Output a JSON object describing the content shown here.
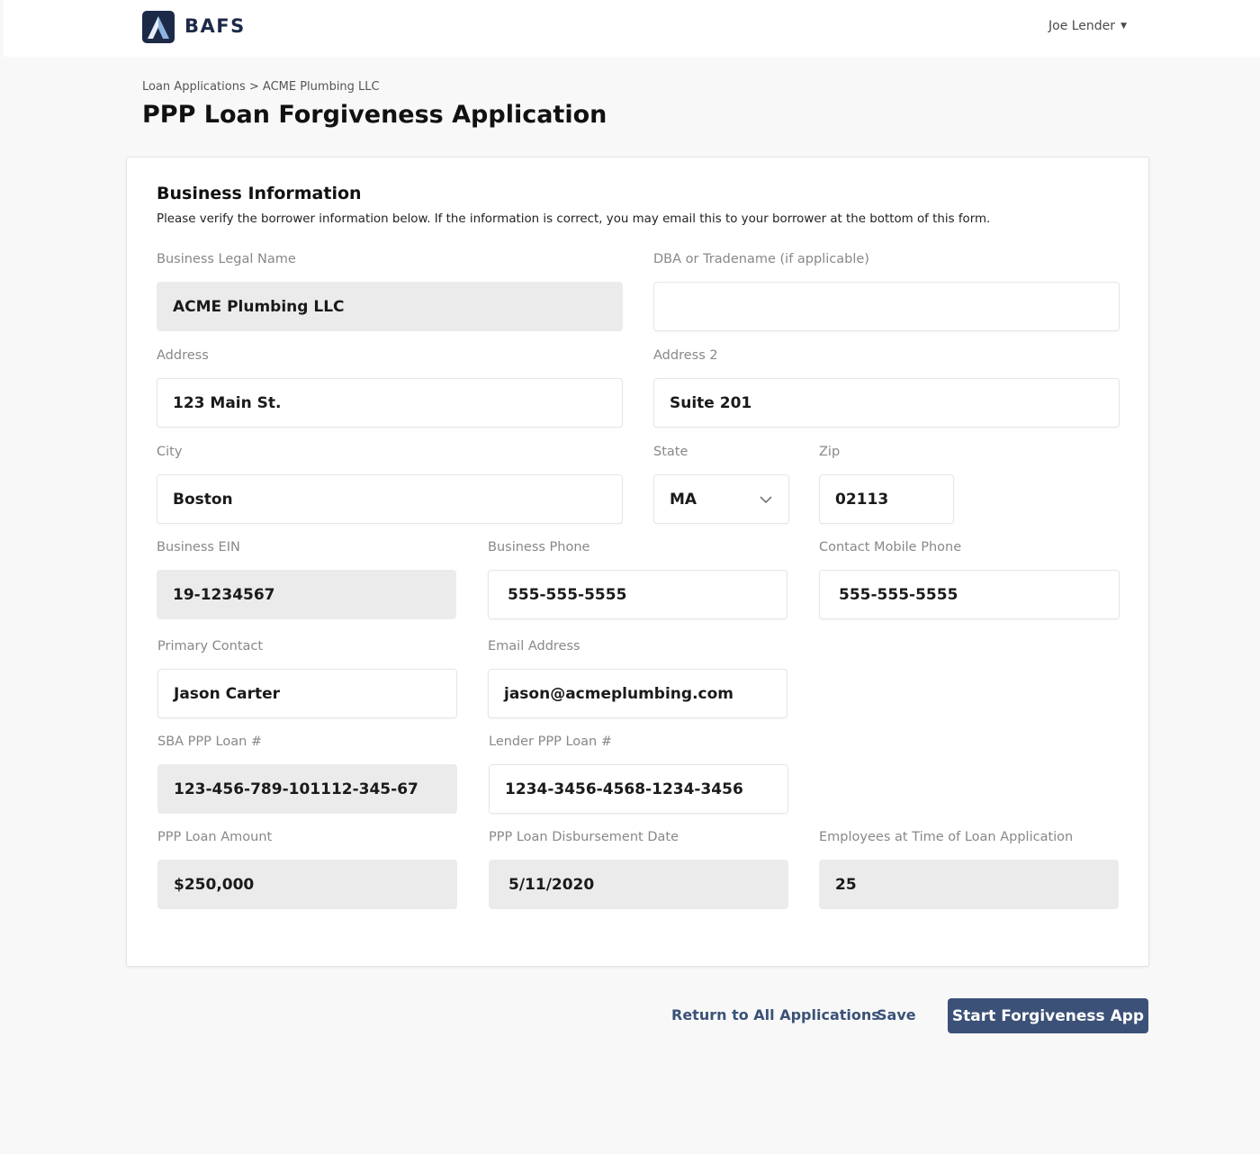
{
  "header": {
    "brand": "BAFS",
    "logo_icon": "bafs-logo-icon",
    "user_name": "Joe Lender",
    "user_menu_icon": "caret-down-icon"
  },
  "breadcrumb": {
    "parent": "Loan Applications",
    "separator": ">",
    "current": "ACME Plumbing LLC",
    "full": "Loan Applications > ACME Plumbing LLC"
  },
  "page": {
    "title": "PPP Loan Forgiveness Application"
  },
  "section": {
    "title": "Business Information",
    "description": "Please verify the borrower information below. If the information is correct, you may email this to your borrower at the bottom of this form."
  },
  "fields": {
    "business_legal_name": {
      "label": "Business Legal Name",
      "value": "ACME Plumbing LLC",
      "readonly": true
    },
    "dba": {
      "label": "DBA or Tradename (if applicable)",
      "value": "",
      "readonly": false
    },
    "address": {
      "label": "Address",
      "value": "123 Main St.",
      "readonly": false
    },
    "address2": {
      "label": "Address 2",
      "value": "Suite 201",
      "readonly": false
    },
    "city": {
      "label": "City",
      "value": "Boston",
      "readonly": false
    },
    "state": {
      "label": "State",
      "value": "MA",
      "readonly": false
    },
    "zip": {
      "label": "Zip",
      "value": "02113",
      "readonly": false
    },
    "ein": {
      "label": "Business EIN",
      "value": "19-1234567",
      "readonly": true
    },
    "business_phone": {
      "label": "Business Phone",
      "value": "555-555-5555",
      "readonly": false
    },
    "mobile_phone": {
      "label": "Contact Mobile Phone",
      "value": "555-555-5555",
      "readonly": false
    },
    "primary_contact": {
      "label": "Primary Contact",
      "value": "Jason Carter",
      "readonly": false
    },
    "email": {
      "label": "Email Address",
      "value": "jason@acmeplumbing.com",
      "readonly": false
    },
    "sba_loan": {
      "label": "SBA PPP Loan #",
      "value": "123-456-789-101112-345-67",
      "readonly": true
    },
    "lender_loan": {
      "label": "Lender PPP Loan #",
      "value": "1234-3456-4568-1234-3456",
      "readonly": false
    },
    "loan_amount": {
      "label": "PPP Loan Amount",
      "value": "$250,000",
      "readonly": true
    },
    "disbursement_date": {
      "label": "PPP Loan Disbursement Date",
      "value": "5/11/2020",
      "readonly": true
    },
    "employees": {
      "label": "Employees at Time of Loan Application",
      "value": "25",
      "readonly": true
    }
  },
  "actions": {
    "return_label": "Return to All Applications",
    "save_label": "Save",
    "start_label": "Start Forgiveness App"
  },
  "colors": {
    "brand": "#1c2a48",
    "primary_button": "#3c5178",
    "link": "#3b5278",
    "readonly_field": "#ebebeb",
    "background": "#f8f8f8"
  }
}
